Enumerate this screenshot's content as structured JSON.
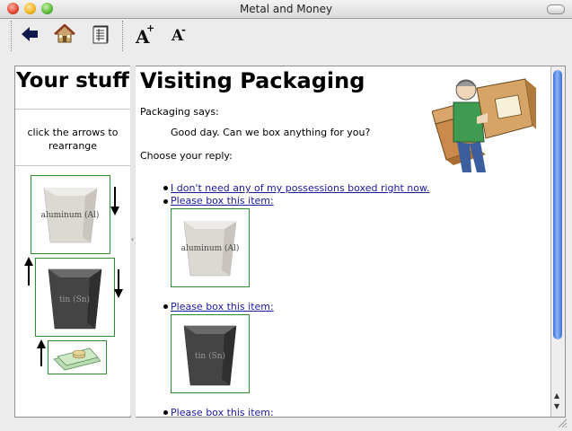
{
  "window": {
    "title": "Metal and Money"
  },
  "toolbar": {
    "back": "back-arrow",
    "home": "home-icon",
    "inventory": "ledger-icon",
    "font_up_label": "A",
    "font_up_mark": "+",
    "font_down_label": "A",
    "font_down_mark": "-"
  },
  "sidebar": {
    "title": "Your stuff",
    "hint_line1": "click the arrows to",
    "hint_line2": "rearrange",
    "items": [
      {
        "label": "aluminum (Al)",
        "color": "#d8d5cf"
      },
      {
        "label": "tin (Sn)",
        "color": "#4a4a4a"
      },
      {
        "label": "money",
        "color": "#9ccc9c"
      }
    ]
  },
  "main": {
    "title": "Visiting Packaging",
    "says": "Packaging says:",
    "quote": "Good day. Can we box anything for you?",
    "prompt": "Choose your reply:",
    "reply_none": "I don't need any of my possessions boxed right now.",
    "reply_box": "Please box this item:",
    "boxed_items": [
      "aluminum (Al)",
      "tin (Sn)"
    ]
  },
  "colors": {
    "accent": "#1a1aa0",
    "frame": "#2e8b2e",
    "scroll": "#3b6fd9"
  }
}
